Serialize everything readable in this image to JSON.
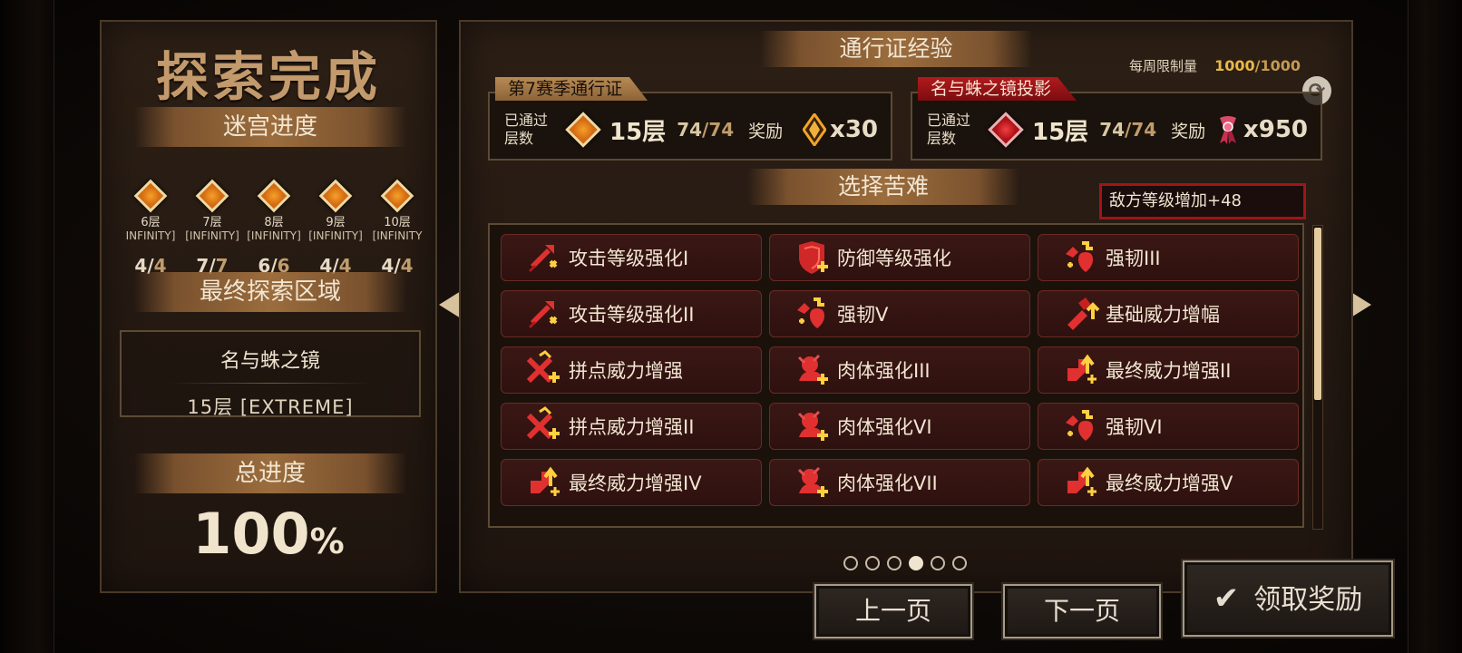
{
  "left": {
    "title": "探索完成",
    "maze_header": "迷宫进度",
    "floors": [
      {
        "name": "6层",
        "tag": "INFINITY]",
        "done": "4",
        "total": "4"
      },
      {
        "name": "7层",
        "tag": "[INFINITY]",
        "done": "7",
        "total": "7"
      },
      {
        "name": "8层",
        "tag": "[INFINITY]",
        "done": "6",
        "total": "6"
      },
      {
        "name": "9层",
        "tag": "[INFINITY]",
        "done": "4",
        "total": "4"
      },
      {
        "name": "10层",
        "tag": "[INFINITY",
        "done": "4",
        "total": "4"
      }
    ],
    "final_zone_header": "最终探索区域",
    "zone_name": "名与蛛之镜",
    "zone_floor": "15层 [EXTREME]",
    "total_header": "总进度",
    "total_value": "100",
    "total_unit": "%"
  },
  "right": {
    "exp_header": "通行证经验",
    "weekly_label": "每周限制量",
    "weekly_current": "1000",
    "weekly_limit": "/1000",
    "season_pass": {
      "tag": "第7赛季通行证",
      "passed_label_1": "已通过",
      "passed_label_2": "层数",
      "floor": "15层",
      "progress_done": "74",
      "progress_total": "/74",
      "reward_label": "奖励",
      "reward_amount": "x30",
      "reward_icon": "amber-crystal-icon"
    },
    "mirror_pass": {
      "tag": "名与蛛之镜投影",
      "passed_label_1": "已通过",
      "passed_label_2": "层数",
      "floor": "15层",
      "progress_done": "74",
      "progress_total": "/74",
      "reward_label": "奖励",
      "reward_amount": "x950",
      "reward_icon": "ribbon-ticket-icon"
    },
    "hardship_header": "选择苦难",
    "enemy_level": "敌方等级增加+48",
    "hardships": [
      {
        "label": "攻击等级强化I",
        "icon": "attack-up-icon"
      },
      {
        "label": "防御等级强化",
        "icon": "shield-plus-icon"
      },
      {
        "label": "强韧III",
        "icon": "toughness-icon"
      },
      {
        "label": "攻击等级强化II",
        "icon": "attack-up-icon"
      },
      {
        "label": "强韧V",
        "icon": "toughness-icon"
      },
      {
        "label": "基础威力增幅",
        "icon": "power-up-icon"
      },
      {
        "label": "拼点威力增强",
        "icon": "clash-power-icon"
      },
      {
        "label": "肉体强化III",
        "icon": "body-up-icon"
      },
      {
        "label": "最终威力增强II",
        "icon": "final-power-icon"
      },
      {
        "label": "拼点威力增强II",
        "icon": "clash-power-icon"
      },
      {
        "label": "肉体强化VI",
        "icon": "body-up-icon"
      },
      {
        "label": "强韧VI",
        "icon": "toughness-icon"
      },
      {
        "label": "最终威力增强IV",
        "icon": "final-power-icon"
      },
      {
        "label": "肉体强化VII",
        "icon": "body-up-icon"
      },
      {
        "label": "最终威力增强V",
        "icon": "final-power-icon"
      }
    ],
    "page_count": 6,
    "active_page_index": 3,
    "prev_label": "上一页",
    "next_label": "下一页",
    "claim_label": "领取奖励"
  }
}
